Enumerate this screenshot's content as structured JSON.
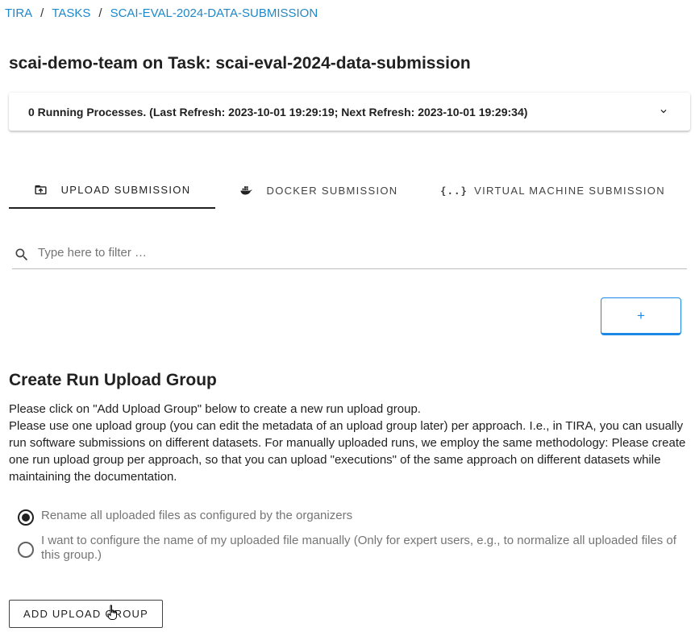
{
  "breadcrumb": {
    "items": [
      "TIRA",
      "TASKS",
      "SCAI-EVAL-2024-DATA-SUBMISSION"
    ],
    "separator": "/"
  },
  "page_title": "scai-demo-team on Task: scai-eval-2024-data-submission",
  "processes": {
    "status_text": "0 Running Processes. (Last Refresh: 2023-10-01 19:29:19; Next Refresh: 2023-10-01 19:29:34)",
    "toggle_icon": "chevron-down-icon"
  },
  "tabs": [
    {
      "label": "UPLOAD SUBMISSION",
      "icon": "folder-upload-icon",
      "active": true
    },
    {
      "label": "DOCKER SUBMISSION",
      "icon": "docker-icon",
      "active": false
    },
    {
      "label": "VIRTUAL MACHINE SUBMISSION",
      "icon": "code-braces-icon",
      "active": false
    }
  ],
  "filter": {
    "placeholder": "Type here to filter …",
    "value": "",
    "icon": "search-icon"
  },
  "add_button": {
    "label": "+"
  },
  "create_group": {
    "title": "Create Run Upload Group",
    "paragraphs": [
      "Please click on \"Add Upload Group\" below to create a new run upload group.",
      "Please use one upload group (you can edit the metadata of an upload group later) per approach. I.e., in TIRA, you can usually run software submissions on different datasets. For manually uploaded runs, we employ the same methodology: Please create one run upload group per approach, so that you can upload \"executions\" of the same approach on different datasets while maintaining the documentation."
    ],
    "options": [
      {
        "label": "Rename all uploaded files as configured by the organizers",
        "selected": true
      },
      {
        "label": "I want to configure the name of my uploaded file manually (Only for expert users, e.g., to normalize all uploaded files of this group.)",
        "selected": false
      }
    ],
    "button_label": "ADD UPLOAD GROUP"
  },
  "colors": {
    "link": "#1e88c9",
    "accent": "#1e88e5",
    "text": "#212121",
    "muted": "#757575"
  }
}
